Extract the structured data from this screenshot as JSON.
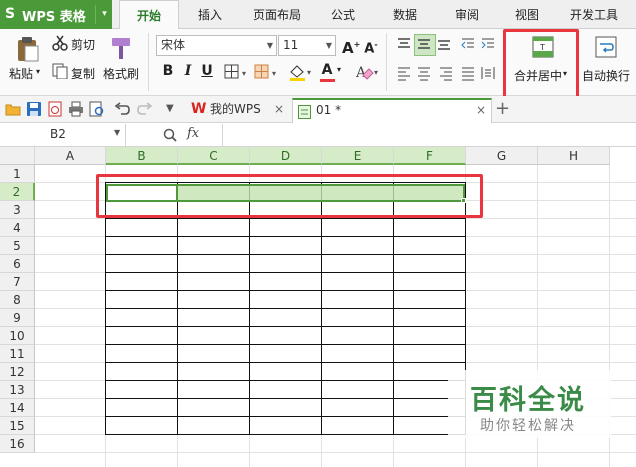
{
  "app": {
    "logo": "S",
    "name": "WPS 表格",
    "menu_arrow": "▾"
  },
  "menu_tabs": [
    {
      "label": "开始",
      "active": true
    },
    {
      "label": "插入"
    },
    {
      "label": "页面布局"
    },
    {
      "label": "公式"
    },
    {
      "label": "数据"
    },
    {
      "label": "审阅"
    },
    {
      "label": "视图"
    },
    {
      "label": "开发工具"
    }
  ],
  "ribbon": {
    "paste": "粘贴",
    "cut": "剪切",
    "copy": "复制",
    "format_painter": "格式刷",
    "font_name": "宋体",
    "font_size": "11",
    "bold": "B",
    "italic": "I",
    "underline": "U",
    "font_color_letter": "A",
    "merge_center": "合并居中",
    "wrap_text": "自动换行",
    "accent_color": "#4a9a3a",
    "highlight_color": "#e8353e"
  },
  "doc_tabs": [
    {
      "label": "我的WPS"
    },
    {
      "label": "01 *"
    }
  ],
  "new_tab": "+",
  "formula_bar": {
    "name_box": "B2",
    "fx": "fx"
  },
  "columns": [
    "A",
    "B",
    "C",
    "D",
    "E",
    "F",
    "G",
    "H"
  ],
  "rows": [
    "1",
    "2",
    "3",
    "4",
    "5",
    "6",
    "7",
    "8",
    "9",
    "10",
    "11",
    "12",
    "13",
    "14",
    "15",
    "16"
  ],
  "selected_range": "B2:F2",
  "watermark": {
    "title": "百科全说",
    "subtitle": "助你轻松解决"
  }
}
